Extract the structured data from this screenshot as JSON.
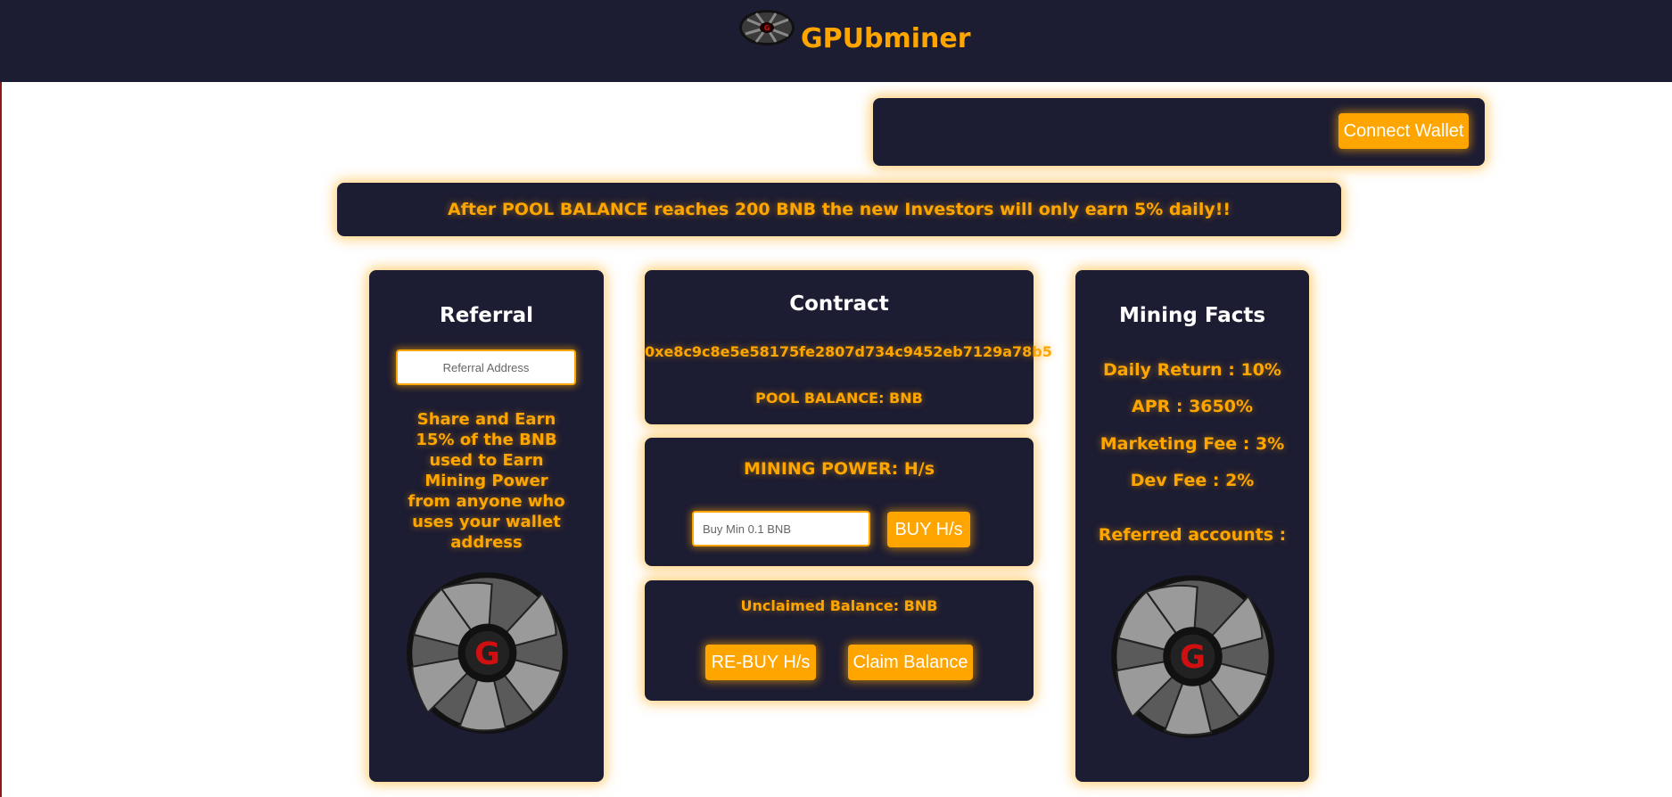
{
  "header": {
    "brand": "GPUbminer",
    "logo_icon": "gpu-fan-icon"
  },
  "wallet": {
    "connect_label": "Connect Wallet"
  },
  "notice": {
    "text": "After POOL BALANCE reaches 200 BNB the new Investors will only earn 5% daily!!"
  },
  "referral": {
    "title": "Referral",
    "input_placeholder": "Referral Address",
    "description": "Share and Earn 15% of the BNB used to Earn Mining Power from anyone who uses your wallet address",
    "image_icon": "gpu-fan-icon"
  },
  "contract": {
    "title": "Contract",
    "address": "0xe8c9c8e5e58175fe2807d734c9452eb7129a78b5",
    "pool_balance": "POOL BALANCE: BNB"
  },
  "mining": {
    "power": "MINING POWER: H/s",
    "input_placeholder": "Buy Min 0.1 BNB",
    "buy_label": "BUY H/s"
  },
  "unclaimed": {
    "balance": "Unclaimed Balance: BNB",
    "rebuy_label": "RE-BUY H/s",
    "claim_label": "Claim Balance"
  },
  "facts": {
    "title": "Mining Facts",
    "items": [
      "Daily Return : 10%",
      "APR : 3650%",
      "Marketing Fee : 3%",
      "Dev Fee : 2%"
    ],
    "referred": "Referred accounts :",
    "image_icon": "gpu-fan-icon"
  },
  "colors": {
    "accent": "#ffa500",
    "panel": "#1c1c32",
    "background": "#ffffff"
  }
}
